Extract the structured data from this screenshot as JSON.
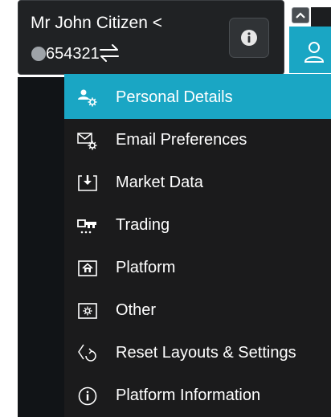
{
  "account": {
    "name": "Mr John Citizen <",
    "number": "654321"
  },
  "colors": {
    "accent": "#1aa6c4",
    "menu_bg": "#1b1b1c",
    "header_bg": "#202224",
    "text": "#ffffff"
  },
  "menu": {
    "items": [
      {
        "label": "Personal Details",
        "icon": "person-gear-icon",
        "selected": true
      },
      {
        "label": "Email Preferences",
        "icon": "envelope-gear-icon",
        "selected": false
      },
      {
        "label": "Market Data",
        "icon": "download-box-icon",
        "selected": false
      },
      {
        "label": "Trading",
        "icon": "key-icon",
        "selected": false
      },
      {
        "label": "Platform",
        "icon": "home-box-icon",
        "selected": false
      },
      {
        "label": "Other",
        "icon": "gear-box-icon",
        "selected": false
      },
      {
        "label": "Reset Layouts & Settings",
        "icon": "reset-icon",
        "selected": false
      },
      {
        "label": "Platform Information",
        "icon": "info-circle-icon",
        "selected": false
      }
    ]
  }
}
